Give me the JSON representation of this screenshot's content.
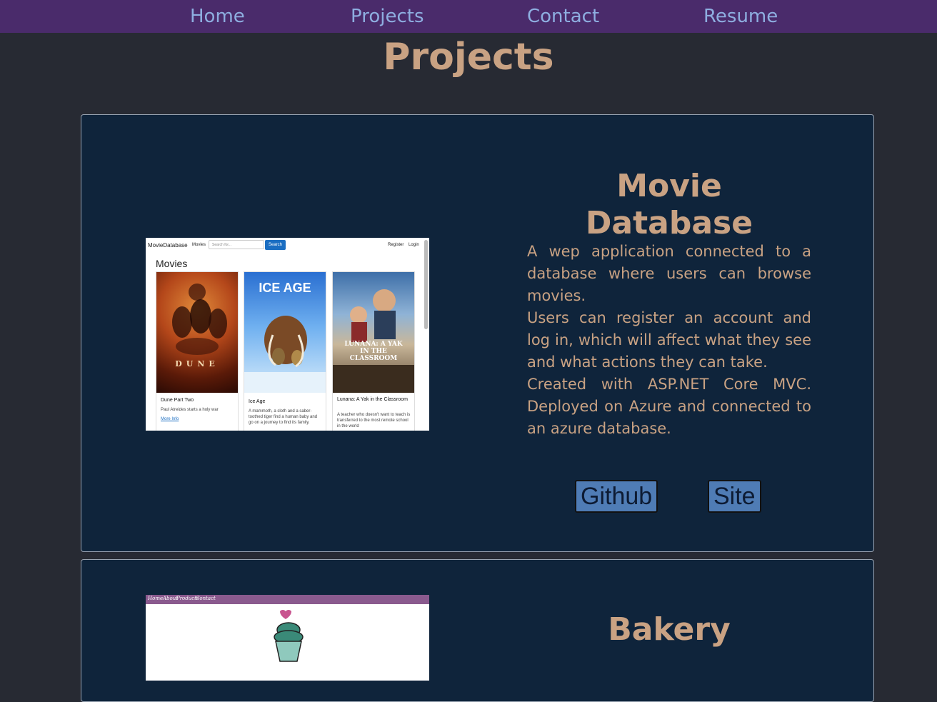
{
  "nav": {
    "items": [
      "Home",
      "Projects",
      "Contact",
      "Resume"
    ]
  },
  "page_title": "Projects",
  "projects": [
    {
      "title": "Movie Database",
      "description": [
        "A wep application connected to a database where users can browse movies.",
        "Users can register an account and log in, which will affect what they see and what actions they can take.",
        "Created with ASP.NET Core MVC. Deployed on Azure and connected to an azure database."
      ],
      "buttons": [
        "Github",
        "Site"
      ],
      "screenshot": {
        "brand": "MovieDatabase",
        "movies_link": "Movies",
        "search_placeholder": "Search for...",
        "search_button": "Search",
        "register": "Register",
        "login": "Login",
        "heading": "Movies",
        "movies": [
          {
            "name": "Dune Part Two",
            "description": "Paul Atreides starts a holy war",
            "more": "More Info",
            "poster_text": "DUNE"
          },
          {
            "name": "Ice Age",
            "description": "A mammoth, a sloth and a saber-toothed tiger find a human baby and go on a journey to find its family.",
            "poster_text": "ICE AGE"
          },
          {
            "name": "Lunana: A Yak in the Classroom",
            "description": "A teacher who doesn't want to teach is transferred to the most remote school in the world",
            "poster_text": "LUNANA: A YAK IN THE CLASSROOM"
          }
        ]
      }
    },
    {
      "title": "Bakery",
      "screenshot": {
        "nav_links": [
          "Home",
          "About",
          "Products",
          "Contact"
        ]
      }
    }
  ],
  "colors": {
    "background": "#272a33",
    "navbar": "#4a2b6b",
    "nav_link": "#8eaee0",
    "accent_text": "#c9a283",
    "card_bg": "#0f243b",
    "button_bg": "#4f7cb5"
  }
}
